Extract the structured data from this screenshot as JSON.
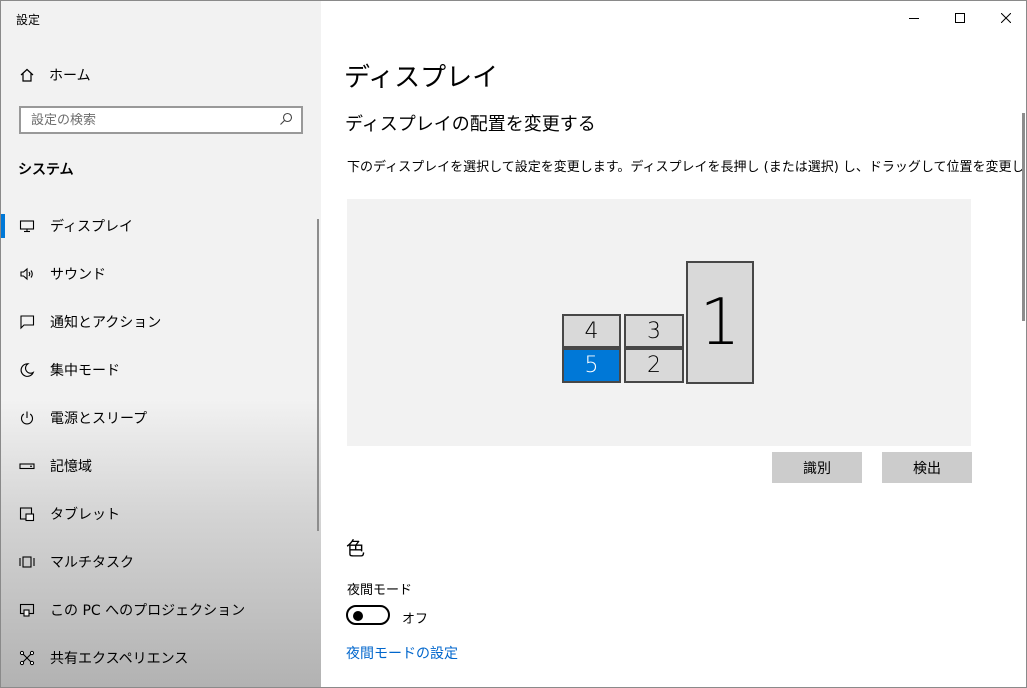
{
  "window": {
    "title": "設定"
  },
  "sidebar": {
    "home_label": "ホーム",
    "search_placeholder": "設定の検索",
    "section_title": "システム",
    "items": [
      {
        "label": "ディスプレイ",
        "icon": "monitor-icon",
        "active": true
      },
      {
        "label": "サウンド",
        "icon": "speaker-icon"
      },
      {
        "label": "通知とアクション",
        "icon": "notification-icon"
      },
      {
        "label": "集中モード",
        "icon": "moon-icon"
      },
      {
        "label": "電源とスリープ",
        "icon": "power-icon"
      },
      {
        "label": "記憶域",
        "icon": "storage-icon"
      },
      {
        "label": "タブレット",
        "icon": "tablet-icon"
      },
      {
        "label": "マルチタスク",
        "icon": "multitask-icon"
      },
      {
        "label": "この PC へのプロジェクション",
        "icon": "projection-icon"
      },
      {
        "label": "共有エクスペリエンス",
        "icon": "shared-icon"
      }
    ]
  },
  "main": {
    "title": "ディスプレイ",
    "arrangement": {
      "heading": "ディスプレイの配置を変更する",
      "description": "下のディスプレイを選択して設定を変更します。ディスプレイを長押し (または選択) し、ドラッグして位置を変更します。",
      "monitors": [
        "1",
        "2",
        "3",
        "4",
        "5"
      ],
      "selected_monitor": "5",
      "identify_label": "識別",
      "detect_label": "検出"
    },
    "color": {
      "heading": "色",
      "night_light_label": "夜間モード",
      "night_light_state": "オフ",
      "night_light_on": false,
      "settings_link": "夜間モードの設定"
    }
  },
  "colors": {
    "accent": "#0078d7",
    "link": "#0066cc",
    "sidebar_bg": "#f2f2f2",
    "button_bg": "#cccccc"
  }
}
